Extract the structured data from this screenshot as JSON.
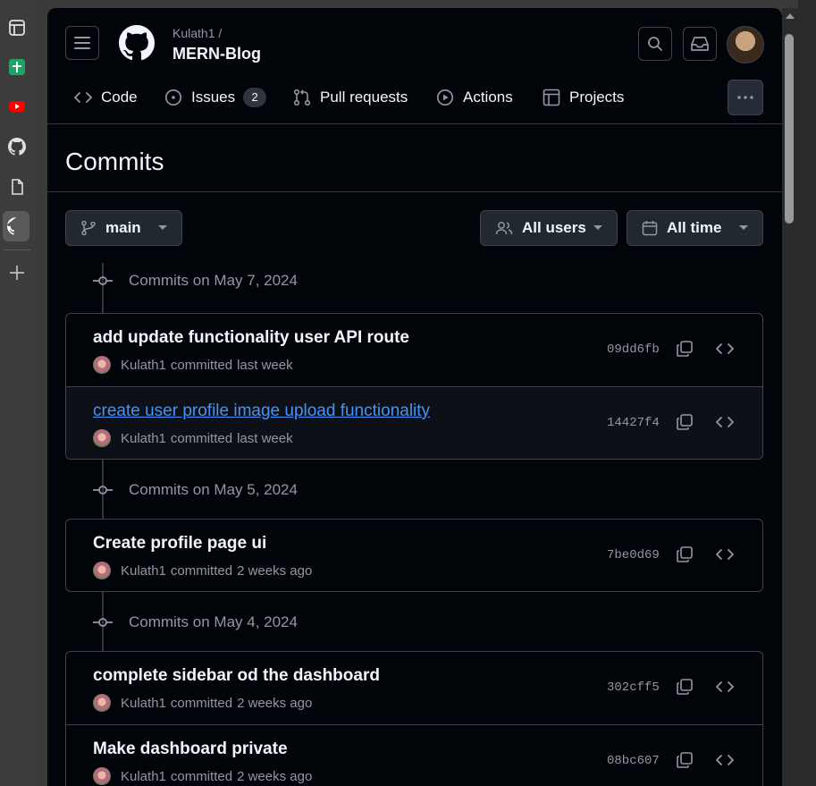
{
  "header": {
    "owner": "Kulath1 /",
    "repo": "MERN-Blog"
  },
  "nav": {
    "code": "Code",
    "issues": "Issues",
    "issues_count": "2",
    "pulls": "Pull requests",
    "actions": "Actions",
    "projects": "Projects"
  },
  "page_title": "Commits",
  "filters": {
    "branch": "main",
    "users": "All users",
    "time": "All time"
  },
  "groups": [
    {
      "heading": "Commits on May 7, 2024",
      "commits": [
        {
          "title": "add update functionality user API route",
          "author": "Kulath1",
          "action": "committed",
          "when": "last week",
          "sha": "09dd6fb"
        },
        {
          "title": "create user profile image upload functionality",
          "author": "Kulath1",
          "action": "committed",
          "when": "last week",
          "sha": "14427f4"
        }
      ]
    },
    {
      "heading": "Commits on May 5, 2024",
      "commits": [
        {
          "title": "Create profile page ui",
          "author": "Kulath1",
          "action": "committed",
          "when": "2 weeks ago",
          "sha": "7be0d69"
        }
      ]
    },
    {
      "heading": "Commits on May 4, 2024",
      "commits": [
        {
          "title": "complete sidebar od the dashboard",
          "author": "Kulath1",
          "action": "committed",
          "when": "2 weeks ago",
          "sha": "302cff5"
        },
        {
          "title": "Make dashboard private",
          "author": "Kulath1",
          "action": "committed",
          "when": "2 weeks ago",
          "sha": "08bc607"
        }
      ]
    }
  ],
  "colors": {
    "background": "#010409",
    "link": "#4493f8",
    "muted": "#9198a1",
    "border": "#3d444d"
  }
}
